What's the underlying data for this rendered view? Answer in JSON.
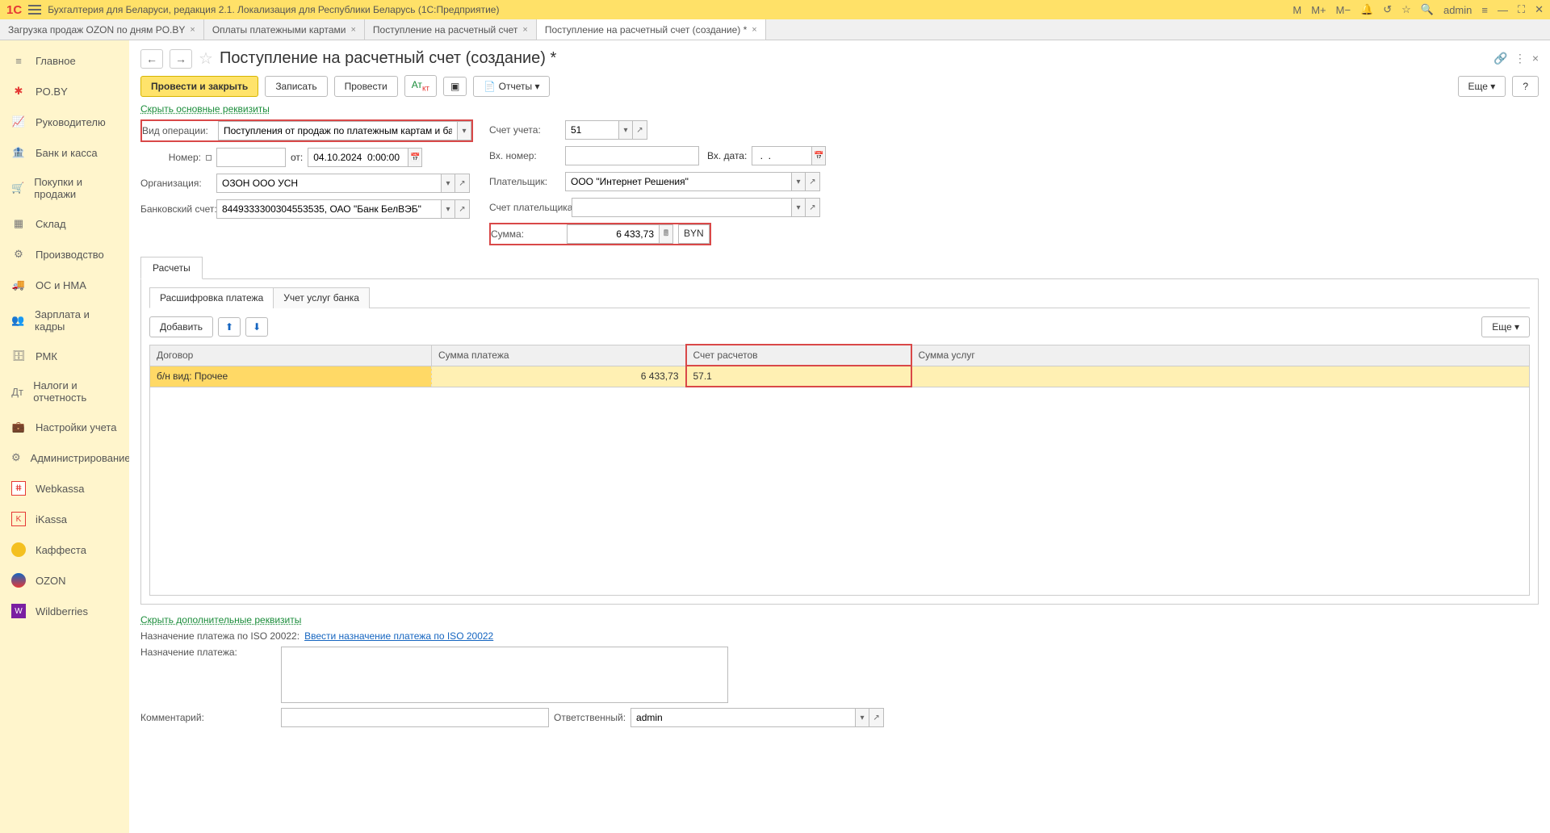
{
  "app": {
    "title": "Бухгалтерия для Беларуси, редакция 2.1. Локализация для Республики Беларусь  (1С:Предприятие)",
    "user": "admin"
  },
  "topIcons": {
    "m": "M",
    "mplus": "M+",
    "mminus": "M−"
  },
  "tabs": [
    {
      "label": "Загрузка продаж OZON по дням PO.BY"
    },
    {
      "label": "Оплаты платежными картами"
    },
    {
      "label": "Поступление на расчетный счет"
    },
    {
      "label": "Поступление на расчетный счет (создание) *",
      "active": true
    }
  ],
  "sidebar": [
    {
      "label": "Главное"
    },
    {
      "label": "PO.BY"
    },
    {
      "label": "Руководителю"
    },
    {
      "label": "Банк и касса"
    },
    {
      "label": "Покупки и продажи"
    },
    {
      "label": "Склад"
    },
    {
      "label": "Производство"
    },
    {
      "label": "ОС и НМА"
    },
    {
      "label": "Зарплата и кадры"
    },
    {
      "label": "РМК"
    },
    {
      "label": "Налоги и отчетность"
    },
    {
      "label": "Настройки учета"
    },
    {
      "label": "Администрирование"
    },
    {
      "label": "Webkassa"
    },
    {
      "label": "iKassa"
    },
    {
      "label": "Каффеста"
    },
    {
      "label": "OZON"
    },
    {
      "label": "Wildberries"
    }
  ],
  "page": {
    "title": "Поступление на расчетный счет (создание) *"
  },
  "toolbar": {
    "postClose": "Провести и закрыть",
    "save": "Записать",
    "post": "Провести",
    "reports": "Отчеты",
    "more": "Еще",
    "help": "?"
  },
  "links": {
    "hideMain": "Скрыть основные реквизиты",
    "hideAdd": "Скрыть дополнительные реквизиты",
    "enterPurpose": "Ввести назначение платежа по ISO 20022"
  },
  "form": {
    "labels": {
      "operationType": "Вид операции:",
      "number": "Номер:",
      "from": "от:",
      "organization": "Организация:",
      "bankAccount": "Банковский счет:",
      "account": "Счет учета:",
      "extNumber": "Вх. номер:",
      "extDate": "Вх. дата:",
      "payer": "Плательщик:",
      "payerAccount": "Счет плательщика:",
      "sum": "Сумма:",
      "purposeIso": "Назначение платежа по ISO 20022:",
      "purpose": "Назначение платежа:",
      "comment": "Комментарий:",
      "responsible": "Ответственный:"
    },
    "values": {
      "operationType": "Поступления от продаж по платежным картам и банковским кре",
      "number": "",
      "date": "04.10.2024  0:00:00",
      "organization": "ОЗОН ООО УСН",
      "bankAccount": "8449333300304553535, ОАО \"Банк БелВЭБ\"",
      "account": "51",
      "extNumber": "",
      "extDate": " .  .    ",
      "payer": "ООО \"Интернет Решения\"",
      "payerAccount": "",
      "sum": "6 433,73",
      "currency": "BYN",
      "responsible": "admin",
      "comment": ""
    }
  },
  "subTabs": {
    "calc": "Расчеты"
  },
  "innerTabs": {
    "breakdown": "Расшифровка платежа",
    "bankServices": "Учет услуг банка"
  },
  "tableToolbar": {
    "add": "Добавить",
    "more": "Еще"
  },
  "tableHeaders": {
    "contract": "Договор",
    "paymentSum": "Сумма платежа",
    "calcAccount": "Счет расчетов",
    "serviceSum": "Сумма услуг"
  },
  "tableRow": {
    "contract": "б/н вид: Прочее",
    "paymentSum": "6 433,73",
    "calcAccount": "57.1",
    "serviceSum": ""
  }
}
